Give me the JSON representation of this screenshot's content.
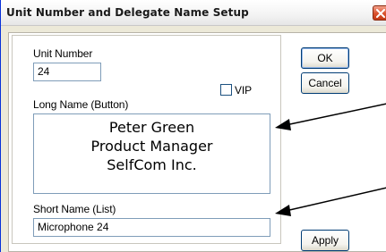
{
  "window": {
    "title": "Unit Number and Delegate Name Setup"
  },
  "form": {
    "unit_number_label": "Unit Number",
    "unit_number_value": "24",
    "vip_label": "VIP",
    "vip_checked": false,
    "long_name_label": "Long Name (Button)",
    "long_name_lines": [
      "Peter Green",
      "Product Manager",
      "SelfCom Inc."
    ],
    "short_name_label": "Short Name (List)",
    "short_name_value": "Microphone 24"
  },
  "buttons": {
    "ok_label": "OK",
    "cancel_label": "Cancel",
    "apply_label": "Apply"
  },
  "icons": {
    "close": "close-icon",
    "callout_arrows": "arrow-icon"
  },
  "colors": {
    "title_text": "#1a1a1a",
    "close_button": "#d9502c",
    "field_border": "#7f9db9",
    "button_border": "#003c74",
    "dialog_face": "#ece9d8"
  }
}
